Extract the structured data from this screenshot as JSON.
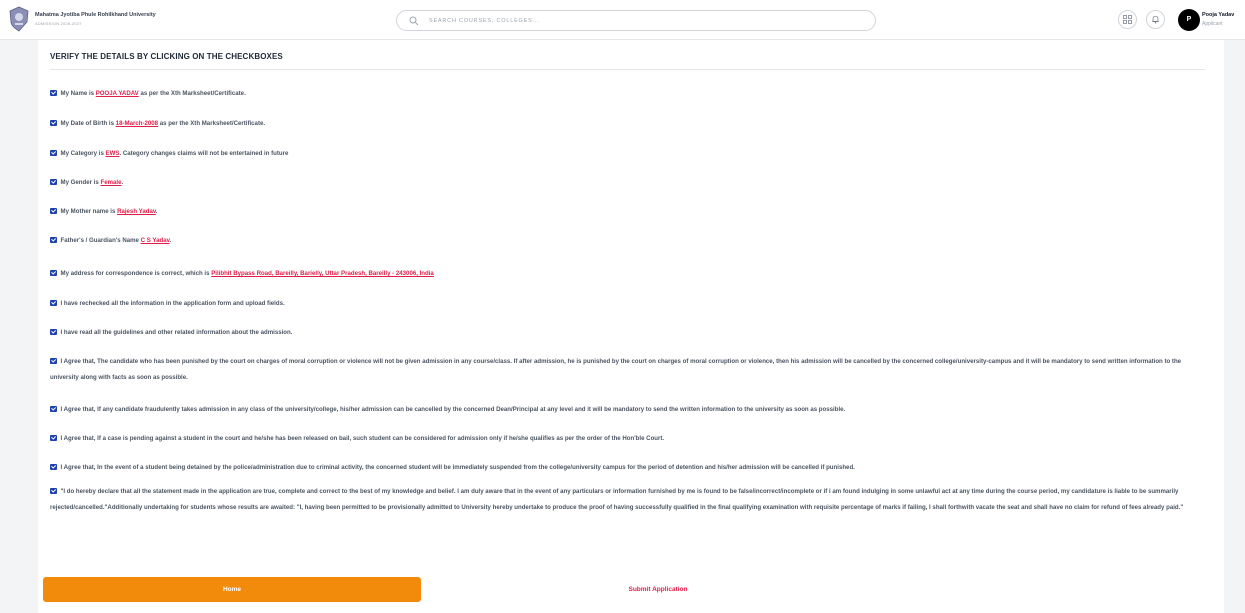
{
  "header": {
    "university_name": "Mahatma Jyotiba Phule Rohilkhand University",
    "subtitle": "ADMISSION 2026-2027",
    "search_placeholder": "SEARCH COURSES, COLLEGES...",
    "icons": [
      "search-icon",
      "apps-grid-icon",
      "bell-icon"
    ],
    "user": {
      "initial": "P",
      "name": "Pooja Yadav",
      "role": "Applicant"
    }
  },
  "verify": {
    "heading": "VERIFY THE DETAILS BY CLICKING ON THE CHECKBOXES",
    "items": [
      {
        "pre": "My Name is ",
        "hl": "POOJA YADAV",
        "post": " as per the Xth Marksheet/Certificate.",
        "checked": true
      },
      {
        "pre": "My Date of Birth is ",
        "hl": "18-March-2008",
        "post": " as per the Xth Marksheet/Certificate.",
        "checked": true
      },
      {
        "pre": "My Category is ",
        "hl": "EWS",
        "post": ". Category changes claims will not be entertained in future",
        "checked": true
      },
      {
        "pre": "My Gender is ",
        "hl": "Female",
        "post": ".",
        "checked": true
      },
      {
        "pre": "My Mother name is ",
        "hl": "Rajesh Yadav",
        "post": ".",
        "checked": true
      },
      {
        "pre": "Father's / Guardian's Name ",
        "hl": "C S Yadav",
        "post": ".",
        "checked": true
      },
      {
        "pre": "My address for correspondence is correct, which is ",
        "hl": "Pilibhit Bypass Road, Bareilly, Barielly, Uttar Pradesh, Bareilly - 243006, India",
        "post": "",
        "checked": true
      },
      {
        "pre": "I have rechecked all the information in the application form and upload fields.",
        "hl": "",
        "post": "",
        "checked": true
      },
      {
        "pre": "I have read all the guidelines and other related information about the admission.",
        "hl": "",
        "post": "",
        "checked": true
      },
      {
        "pre": "I Agree that, The candidate who has been punished by the court on charges of moral corruption or violence will not be given admission in any course/class. If after admission, he is punished by the court on charges of moral corruption or violence, then his admission will be cancelled by the concerned college/university-campus and it will be mandatory to send written information to the university along with facts as soon as possible.",
        "hl": "",
        "post": "",
        "checked": true
      },
      {
        "pre": "I Agree that, If any candidate fraudulently takes admission in any class of the university/college, his/her admission can be cancelled by the concerned Dean/Principal at any level and it will be mandatory to send the written information to the university as soon as possible.",
        "hl": "",
        "post": "",
        "checked": true
      },
      {
        "pre": "I Agree that, If a case is pending against a student in the court and he/she has been released on bail, such student can be considered for admission only if he/she qualifies as per the order of the Hon'ble Court.",
        "hl": "",
        "post": "",
        "checked": true
      },
      {
        "pre": "I Agree that, In the event of a student being detained by the police/administration due to criminal activity, the concerned student will be immediately suspended from the college/university campus for the period of detention and his/her admission will be cancelled if punished.",
        "hl": "",
        "post": "",
        "checked": true
      },
      {
        "pre": "\"I do hereby declare that all the statement made in the application are true, complete and correct to the best of my knowledge and belief. I am duly aware that in the event of any particulars or information furnished by me is found to be false/incorrect/incomplete or if i am found indulging in some unlawful act at any time during the course period, my candidature is liable to be summarily rejected/cancelled.\"Additionally undertaking for students whose results are awaited: \"I, having been permitted to be provisionally admitted to University hereby undertake to produce the proof of having successfully qualified in the final qualifying examination with requisite percentage of marks if failing, I shall forthwith vacate the seat and shall have no claim for refund of fees already paid.\"",
        "hl": "",
        "post": "",
        "checked": true
      }
    ]
  },
  "actions": {
    "home_label": "Home",
    "submit_label": "Submit Application"
  },
  "colors": {
    "accent": "#f28b0c",
    "highlight": "#e11d48",
    "checkbox": "#1e40af"
  }
}
